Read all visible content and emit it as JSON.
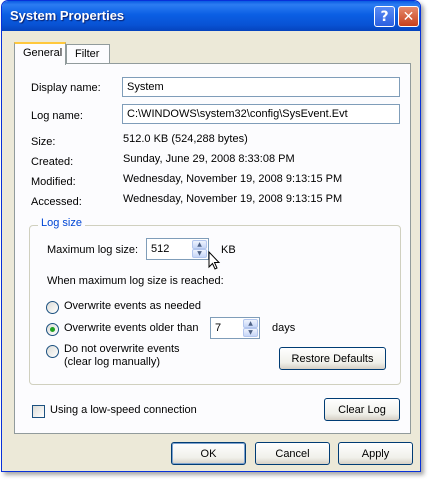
{
  "window": {
    "title": "System Properties"
  },
  "tabs": [
    {
      "label": "General"
    },
    {
      "label": "Filter"
    }
  ],
  "general": {
    "display_name": {
      "label": "Display name:",
      "value": "System"
    },
    "log_name": {
      "label": "Log name:",
      "value": "C:\\WINDOWS\\system32\\config\\SysEvent.Evt"
    },
    "size": {
      "label": "Size:",
      "value": "512.0 KB (524,288 bytes)"
    },
    "created": {
      "label": "Created:",
      "value": "Sunday, June 29, 2008 8:33:08 PM"
    },
    "modified": {
      "label": "Modified:",
      "value": "Wednesday, November 19, 2008 9:13:15 PM"
    },
    "accessed": {
      "label": "Accessed:",
      "value": "Wednesday, November 19, 2008 9:13:15 PM"
    }
  },
  "log_size": {
    "group_title": "Log size",
    "max_label": "Maximum log size:",
    "max_value": "512",
    "max_unit": "KB",
    "when_reached_label": "When maximum log size is reached:",
    "options": [
      {
        "label": "Overwrite events as needed",
        "selected": false
      },
      {
        "label": "Overwrite events older than",
        "selected": true
      },
      {
        "label": "Do not overwrite events",
        "sublabel": "(clear log manually)",
        "selected": false
      }
    ],
    "days_value": "7",
    "days_unit": "days",
    "restore_button": "Restore Defaults"
  },
  "low_speed": {
    "label": "Using a low-speed connection",
    "checked": false
  },
  "clear_log_button": "Clear Log",
  "footer": {
    "ok": "OK",
    "cancel": "Cancel",
    "apply": "Apply"
  },
  "icons": {
    "help": "help-icon",
    "close": "close-icon",
    "cursor": "mouse-pointer-icon"
  },
  "colors": {
    "title_bar": "#0b5fe4",
    "group_title": "#0046d5",
    "selected_radio": "#21a121",
    "tab_highlight": "#ffc83c"
  }
}
